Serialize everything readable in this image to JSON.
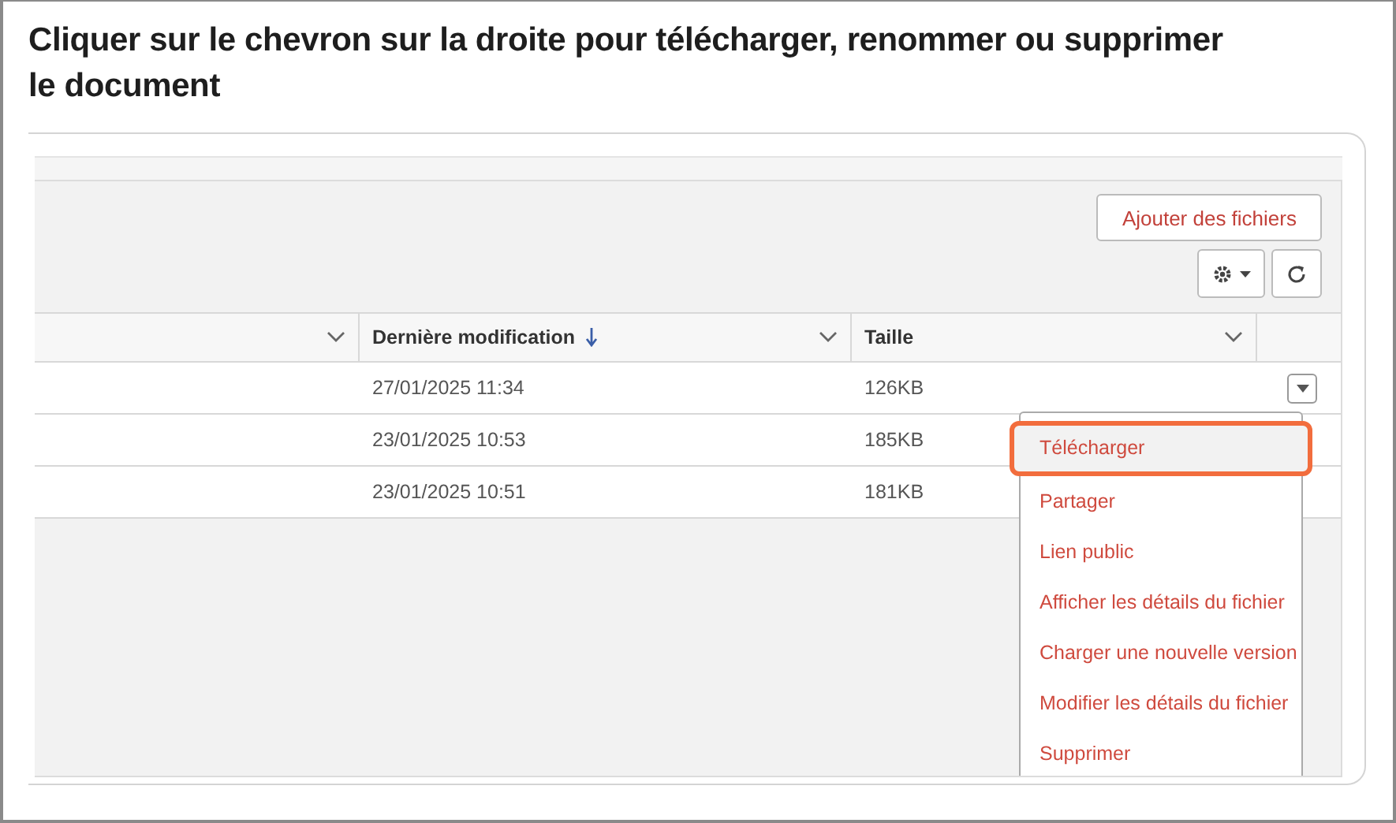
{
  "heading": "Cliquer sur le chevron sur la droite pour télécharger, renommer ou supprimer le document",
  "toolbar": {
    "add_button": "Ajouter des fichiers"
  },
  "table": {
    "columns": [
      {
        "sorted": false
      },
      {
        "label": "Dernière modification",
        "sorted": true
      },
      {
        "label": "Taille",
        "sorted": false
      }
    ],
    "rows": [
      {
        "modified": "27/01/2025 11:34",
        "size": "126KB",
        "menu_open": true
      },
      {
        "modified": "23/01/2025 10:53",
        "size": "185KB",
        "menu_open": false
      },
      {
        "modified": "23/01/2025 10:51",
        "size": "181KB",
        "menu_open": false
      }
    ]
  },
  "menu": {
    "items": [
      {
        "label": "Télécharger",
        "selected": true
      },
      {
        "label": "Partager",
        "selected": false
      },
      {
        "label": "Lien public",
        "selected": false
      },
      {
        "label": "Afficher les détails du fichier",
        "selected": false
      },
      {
        "label": "Charger une nouvelle version",
        "selected": false
      },
      {
        "label": "Modifier les détails du fichier",
        "selected": false
      },
      {
        "label": "Supprimer",
        "selected": false
      }
    ]
  }
}
